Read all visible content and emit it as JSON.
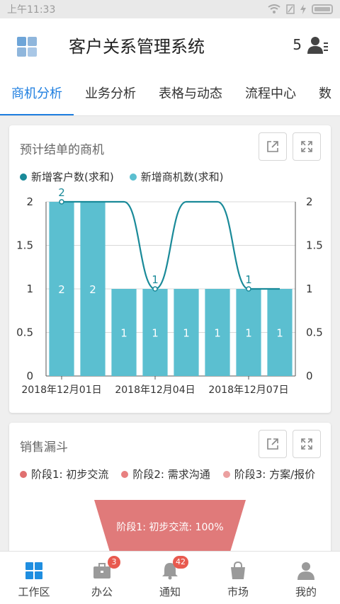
{
  "status_bar": {
    "time": "上午11:33"
  },
  "header": {
    "title": "客户关系管理系统",
    "user_count": "5"
  },
  "tabs": [
    {
      "label": "商机分析",
      "active": true
    },
    {
      "label": "业务分析"
    },
    {
      "label": "表格与动态"
    },
    {
      "label": "流程中心"
    },
    {
      "label": "数"
    }
  ],
  "card1": {
    "title": "预计结单的商机",
    "legend": [
      {
        "label": "新增客户数(求和)",
        "color": "#1a8a99"
      },
      {
        "label": "新增商机数(求和)",
        "color": "#5bbfd0"
      }
    ]
  },
  "chart_data": {
    "type": "bar",
    "categories": [
      "2018年12月01日",
      "2018年12月02日",
      "2018年12月03日",
      "2018年12月04日",
      "2018年12月05日",
      "2018年12月06日",
      "2018年12月07日",
      "2018年12月08日"
    ],
    "tick_labels": [
      "2018年12月01日",
      "2018年12月04日",
      "2018年12月07日"
    ],
    "y_ticks": [
      "0",
      "0.5",
      "1",
      "1.5",
      "2"
    ],
    "ylim": [
      0,
      2
    ],
    "series": [
      {
        "name": "新增商机数(求和)",
        "type": "bar",
        "color": "#5bbfd0",
        "values": [
          2,
          2,
          1,
          1,
          1,
          1,
          1,
          1
        ]
      },
      {
        "name": "新增客户数(求和)",
        "type": "line",
        "color": "#1a8a99",
        "values": [
          2,
          2,
          2,
          1,
          2,
          2,
          1,
          1
        ],
        "labeled_points": [
          0,
          3,
          6
        ]
      }
    ]
  },
  "card2": {
    "title": "销售漏斗",
    "legend": [
      {
        "label": "阶段1: 初步交流",
        "color": "#e07070"
      },
      {
        "label": "阶段2: 需求沟通",
        "color": "#e88080"
      },
      {
        "label": "阶段3: 方案/报价",
        "color": "#eba0a0"
      }
    ],
    "funnel_label": "阶段1: 初步交流: 100%"
  },
  "bottom_nav": [
    {
      "label": "工作区",
      "icon": "grid-icon",
      "active": true
    },
    {
      "label": "办公",
      "icon": "briefcase-icon",
      "badge": "3"
    },
    {
      "label": "通知",
      "icon": "bell-icon",
      "badge": "42"
    },
    {
      "label": "市场",
      "icon": "shopping-bag-icon"
    },
    {
      "label": "我的",
      "icon": "person-icon"
    }
  ]
}
